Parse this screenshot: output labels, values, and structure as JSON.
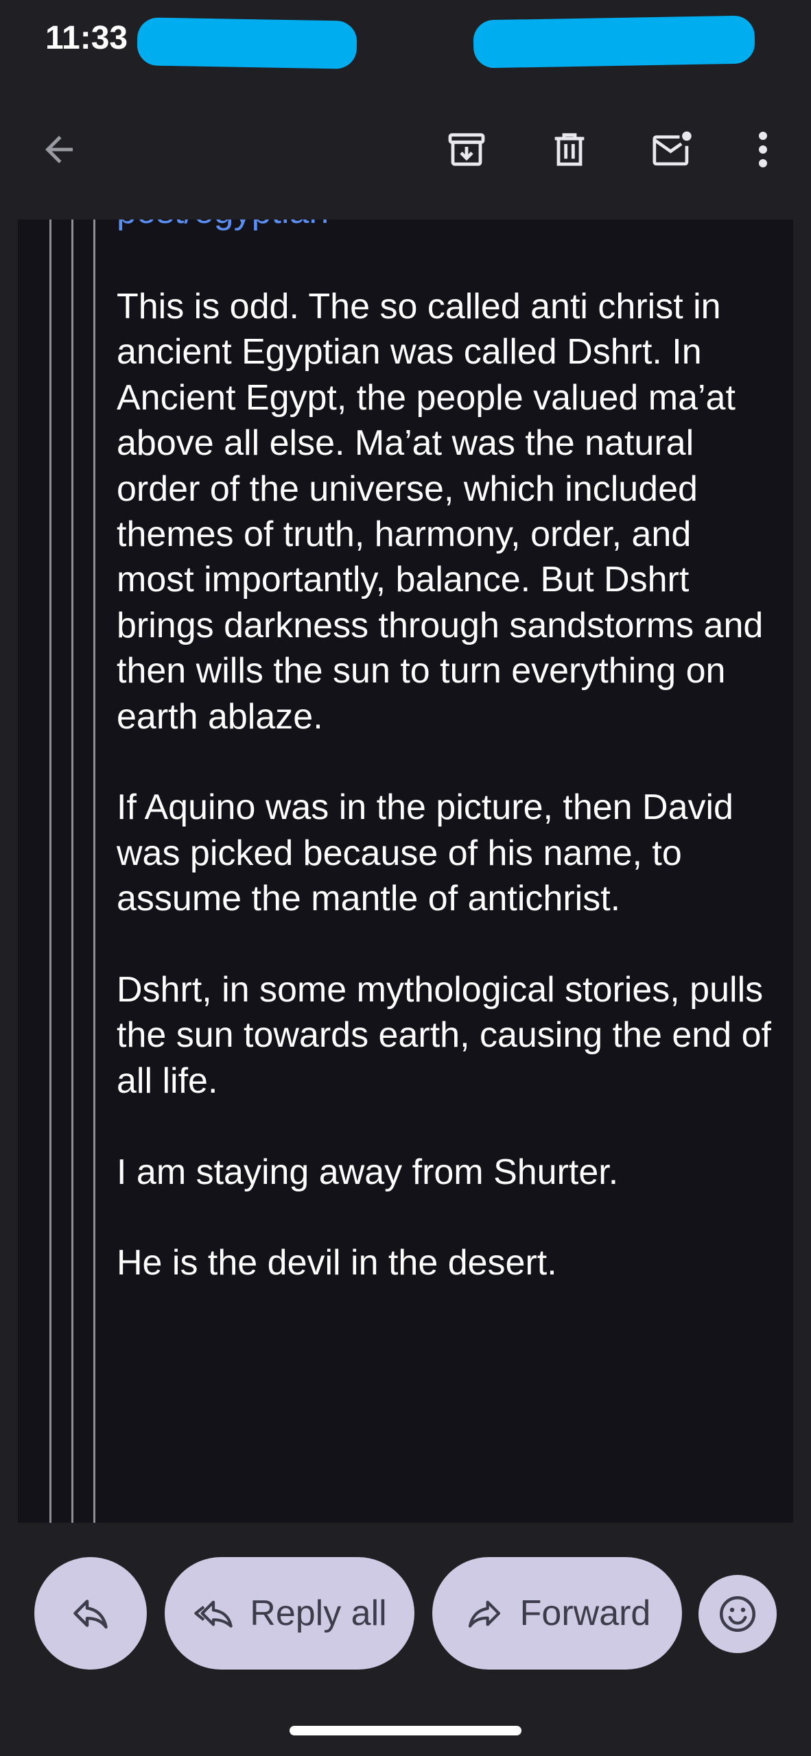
{
  "status_bar": {
    "time": "11:33"
  },
  "toolbar": {
    "icons": [
      "back-arrow-icon",
      "archive-icon",
      "trash-icon",
      "mark-unread-icon",
      "more-vert-icon"
    ]
  },
  "message": {
    "link_partial": "post/egyptian",
    "paragraphs": [
      "This is odd. The so called anti christ in ancient Egyptian was called Dshrt. In Ancient Egypt, the people valued ma’at above all else. Ma’at was the natural order of the universe, which included themes of truth, harmony, order, and most importantly, balance. But Dshrt brings darkness through sandstorms and then wills the sun to turn everything on earth ablaze.",
      "If Aquino was in the picture, then David was picked because of his name, to assume the mantle of antichrist.",
      "Dshrt, in some mythological stories, pulls the sun towards earth, causing the end of all life.",
      "I am staying away from Shurter.",
      "He is the devil in the desert."
    ]
  },
  "actions": {
    "reply_all_label": "Reply all",
    "forward_label": "Forward"
  },
  "colors": {
    "background": "#1f1f24",
    "content_background": "#121218",
    "pill": "#cfcbe5",
    "link": "#5b8ef0",
    "redaction": "#00aeef"
  }
}
